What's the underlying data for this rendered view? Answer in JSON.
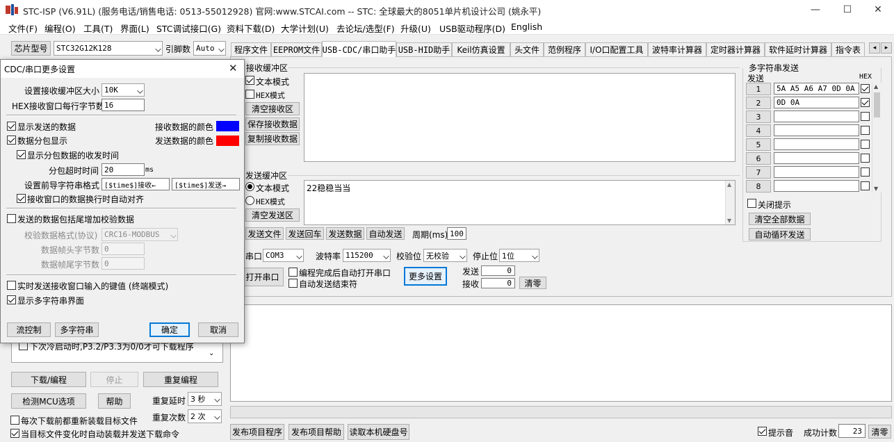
{
  "window": {
    "title": "STC-ISP (V6.91L) (服务电话/销售电话: 0513-55012928) 官网:www.STCAI.com  -- STC: 全球最大的8051单片机设计公司 (姚永平)",
    "minimize": "—",
    "maximize": "☐",
    "close": "✕"
  },
  "menu": [
    "文件(F)",
    "编程(O)",
    "工具(T)",
    "界面(L)",
    "STC调试接口(G)",
    "资料下载(D)",
    "大学计划(U)",
    "去论坛/选型(F)",
    "升级(U)",
    "USB驱动程序(D)",
    "English"
  ],
  "chip": {
    "type_label": "芯片型号",
    "type_value": "STC32G12K128",
    "pin_label": "引脚数",
    "pin_value": "Auto"
  },
  "tabs": [
    "程序文件",
    "EEPROM文件",
    "USB-CDC/串口助手",
    "USB-HID助手",
    "Keil仿真设置",
    "头文件",
    "范例程序",
    "I/O口配置工具",
    "波特率计算器",
    "定时器计算器",
    "软件延时计算器",
    "指令表"
  ],
  "tab_scroll": {
    "left": "◂",
    "right": "▸"
  },
  "receive": {
    "title": "接收缓冲区",
    "text_mode": "文本模式",
    "hex_mode": "HEX模式",
    "clear": "清空接收区",
    "save": "保存接收数据",
    "copy": "复制接收数据"
  },
  "send": {
    "title": "发送缓冲区",
    "text_mode": "文本模式",
    "hex_mode": "HEX模式",
    "clear": "清空发送区",
    "content": "22稳稳当当",
    "send_file": "发送文件",
    "send_return": "发送回车",
    "send_data": "发送数据",
    "auto_send": "自动发送",
    "period_label": "周期(ms)",
    "period_value": "100"
  },
  "serial": {
    "port_label": "串口",
    "port_value": "COM3",
    "baud_label": "波特率",
    "baud_value": "115200",
    "parity_label": "校验位",
    "parity_value": "无校验",
    "stop_label": "停止位",
    "stop_value": "1位",
    "open_button": "打开串口",
    "auto_open": "编程完成后自动打开串口",
    "auto_end": "自动发送结束符",
    "more_settings": "更多设置",
    "tx_label": "发送",
    "tx_value": "0",
    "rx_label": "接收",
    "rx_value": "0",
    "clear_counts": "清零"
  },
  "multi": {
    "title": "多字符串发送",
    "send_header": "发送",
    "hex_header": "HEX",
    "rows": [
      {
        "num": "1",
        "value": "5A A5 A6 A7 0D 0A"
      },
      {
        "num": "2",
        "value": "0D 0A"
      },
      {
        "num": "3",
        "value": ""
      },
      {
        "num": "4",
        "value": ""
      },
      {
        "num": "5",
        "value": ""
      },
      {
        "num": "6",
        "value": ""
      },
      {
        "num": "7",
        "value": ""
      },
      {
        "num": "8",
        "value": ""
      }
    ],
    "close_hint": "关闭提示",
    "clear_all": "清空全部数据",
    "auto_loop": "自动循环发送"
  },
  "left_panel": {
    "cold_boot_option": "下次冷启动时,P3.2/P3.3为0/0才可下载程序",
    "download": "下载/编程",
    "stop": "停止",
    "reprogram": "重复编程",
    "check_mcu": "检测MCU选项",
    "help": "帮助",
    "repeat_delay_label": "重复延时",
    "repeat_delay_value": "3 秒",
    "repeat_count_label": "重复次数",
    "repeat_count_value": "2 次",
    "reload_before_download": "每次下载前都重新装载目标文件",
    "auto_reload": "当目标文件变化时自动装载并发送下载命令"
  },
  "bottom": {
    "publish_program": "发布项目程序",
    "publish_help": "发布项目帮助",
    "read_disk_id": "读取本机硬盘号",
    "beep": "提示音",
    "success_count_label": "成功计数",
    "success_count_value": "23",
    "clear": "清零"
  },
  "dialog": {
    "title": "CDC/串口更多设置",
    "close": "✕",
    "rx_buf_label": "设置接收缓冲区大小",
    "rx_buf_value": "10K",
    "hex_bytes_label": "HEX接收窗口每行字节数",
    "hex_bytes_value": "16",
    "show_sent": "显示发送的数据",
    "rx_color_label": "接收数据的颜色",
    "rx_color": "#0000ff",
    "split_packets": "数据分包显示",
    "tx_color_label": "发送数据的颜色",
    "tx_color": "#ff0000",
    "show_packet_time": "显示分包数据的收发时间",
    "packet_timeout_label": "分包超时时间",
    "packet_timeout_value": "20",
    "packet_timeout_unit": "ms",
    "prefix_label": "设置前导字符串格式",
    "rx_prefix": "[$time$]接收←",
    "tx_prefix": "[$time$]发送→",
    "auto_align": "接收窗口的数据换行时自动对齐",
    "append_checksum": "发送的数据包括尾增加校验数据",
    "checksum_format_label": "校验数据格式(协议)",
    "checksum_format_value": "CRC16-MODBUS",
    "header_bytes_label": "数据帧头字节数",
    "header_bytes_value": "0",
    "tail_bytes_label": "数据帧尾字节数",
    "tail_bytes_value": "0",
    "realtime_keys": "实时发送接收窗口输入的键值 (终端模式)",
    "show_multi": "显示多字符串界面",
    "flow_control": "流控制",
    "multi_string": "多字符串",
    "ok": "确定",
    "cancel": "取消"
  }
}
